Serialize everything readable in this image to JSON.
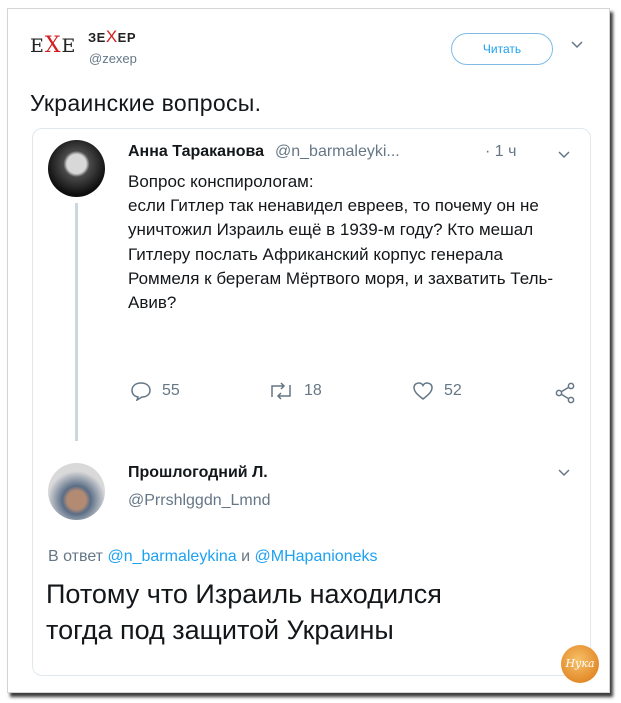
{
  "account": {
    "logo_left": "E",
    "logo_x": "X",
    "logo_right": "E",
    "name_left": "ЗЕ",
    "name_x": "Х",
    "name_right": "ЕР",
    "handle": "@zexep"
  },
  "follow_label": "Читать",
  "tweet_text": "Украинские вопросы.",
  "quoted": {
    "author_name": "Анна Тараканова",
    "author_handle": "@n_barmaleyki...",
    "time": "· 1 ч",
    "text": "Вопрос конспирологам:\nесли Гитлер так ненавидел евреев, то почему он не уничтожил Израиль ещё в 1939-м году? Кто мешал Гитлеру послать Африканский корпус генерала Роммеля к берегам Мёртвого моря, и захватить Тель-Авив?",
    "replies": "55",
    "retweets": "18",
    "likes": "52"
  },
  "reply": {
    "author_name": "Прошлогодний Л.",
    "author_handle": "@Prrshlggdn_Lmnd",
    "reply_prefix": "В ответ",
    "reply_user1": "@n_barmaleykina",
    "reply_and": "и",
    "reply_user2": "@MHapanioneks",
    "text": "Потому что Израиль находился\nтогда под защитой Украины"
  },
  "watermark_text": "Нука",
  "colors": {
    "accent": "#1da1f2",
    "muted": "#657786",
    "logo_red": "#d31f1f"
  }
}
